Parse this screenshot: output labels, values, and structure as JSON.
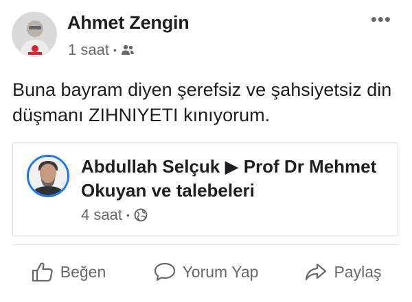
{
  "post": {
    "author": "Ahmet Zengin",
    "time": "1 saat",
    "audience_icon": "friends-icon",
    "text": "Buna bayram diyen şerefsiz ve şahsiyetsiz din düşmanı ZIHNIYETI  kınıyorum."
  },
  "shared": {
    "title": "Abdullah Selçuk ▶ Prof Dr Mehmet Okuyan ve talebeleri",
    "time": "4 saat",
    "audience_icon": "globe-icon"
  },
  "actions": {
    "like_label": "Beğen",
    "comment_label": "Yorum Yap",
    "share_label": "Paylaş"
  },
  "colors": {
    "text": "#1c1e21",
    "secondary": "#65676b",
    "accent": "#1877f2"
  }
}
